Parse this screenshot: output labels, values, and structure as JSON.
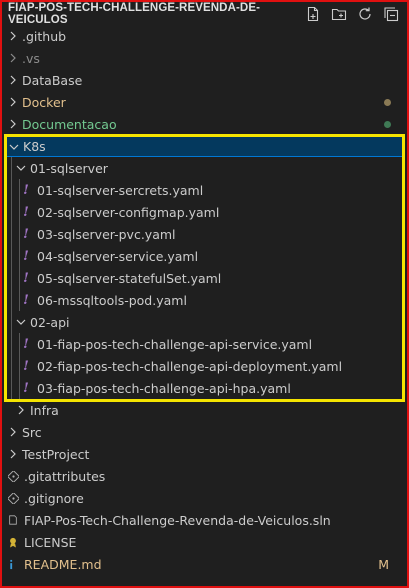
{
  "explorer": {
    "title": "FIAP-POS-TECH-CHALLENGE-REVENDA-DE-VEICULOS",
    "actions": [
      {
        "name": "new-file-icon"
      },
      {
        "name": "new-folder-icon"
      },
      {
        "name": "refresh-icon"
      },
      {
        "name": "collapse-all-icon"
      }
    ]
  },
  "tree": {
    "github": ".github",
    "vs": ".vs",
    "database": "DataBase",
    "docker": "Docker",
    "documentacao": "Documentacao",
    "k8s": "K8s",
    "sqlserver": "01-sqlserver",
    "sql_files": [
      "01-sqlserver-sercrets.yaml",
      "02-sqlserver-configmap.yaml",
      "03-sqlserver-pvc.yaml",
      "04-sqlserver-service.yaml",
      "05-sqlserver-statefulSet.yaml",
      "06-mssqltools-pod.yaml"
    ],
    "api": "02-api",
    "api_files": [
      "01-fiap-pos-tech-challenge-api-service.yaml",
      "02-fiap-pos-tech-challenge-api-deployment.yaml",
      "03-fiap-pos-tech-challenge-api-hpa.yaml"
    ],
    "infra": "Infra",
    "src": "Src",
    "testproject": "TestProject",
    "gitattributes": ".gitattributes",
    "gitignore": ".gitignore",
    "sln": "FIAP-Pos-Tech-Challenge-Revenda-de-Veiculos.sln",
    "license": "LICENSE",
    "readme": "README.md",
    "readme_badge": "M"
  },
  "colors": {
    "docker": "#e2c08d",
    "documentacao": "#73c991",
    "vs": "#8c8c8c",
    "readme": "#e2c08d",
    "selection": "#04395e",
    "highlight": "#f5e400"
  }
}
